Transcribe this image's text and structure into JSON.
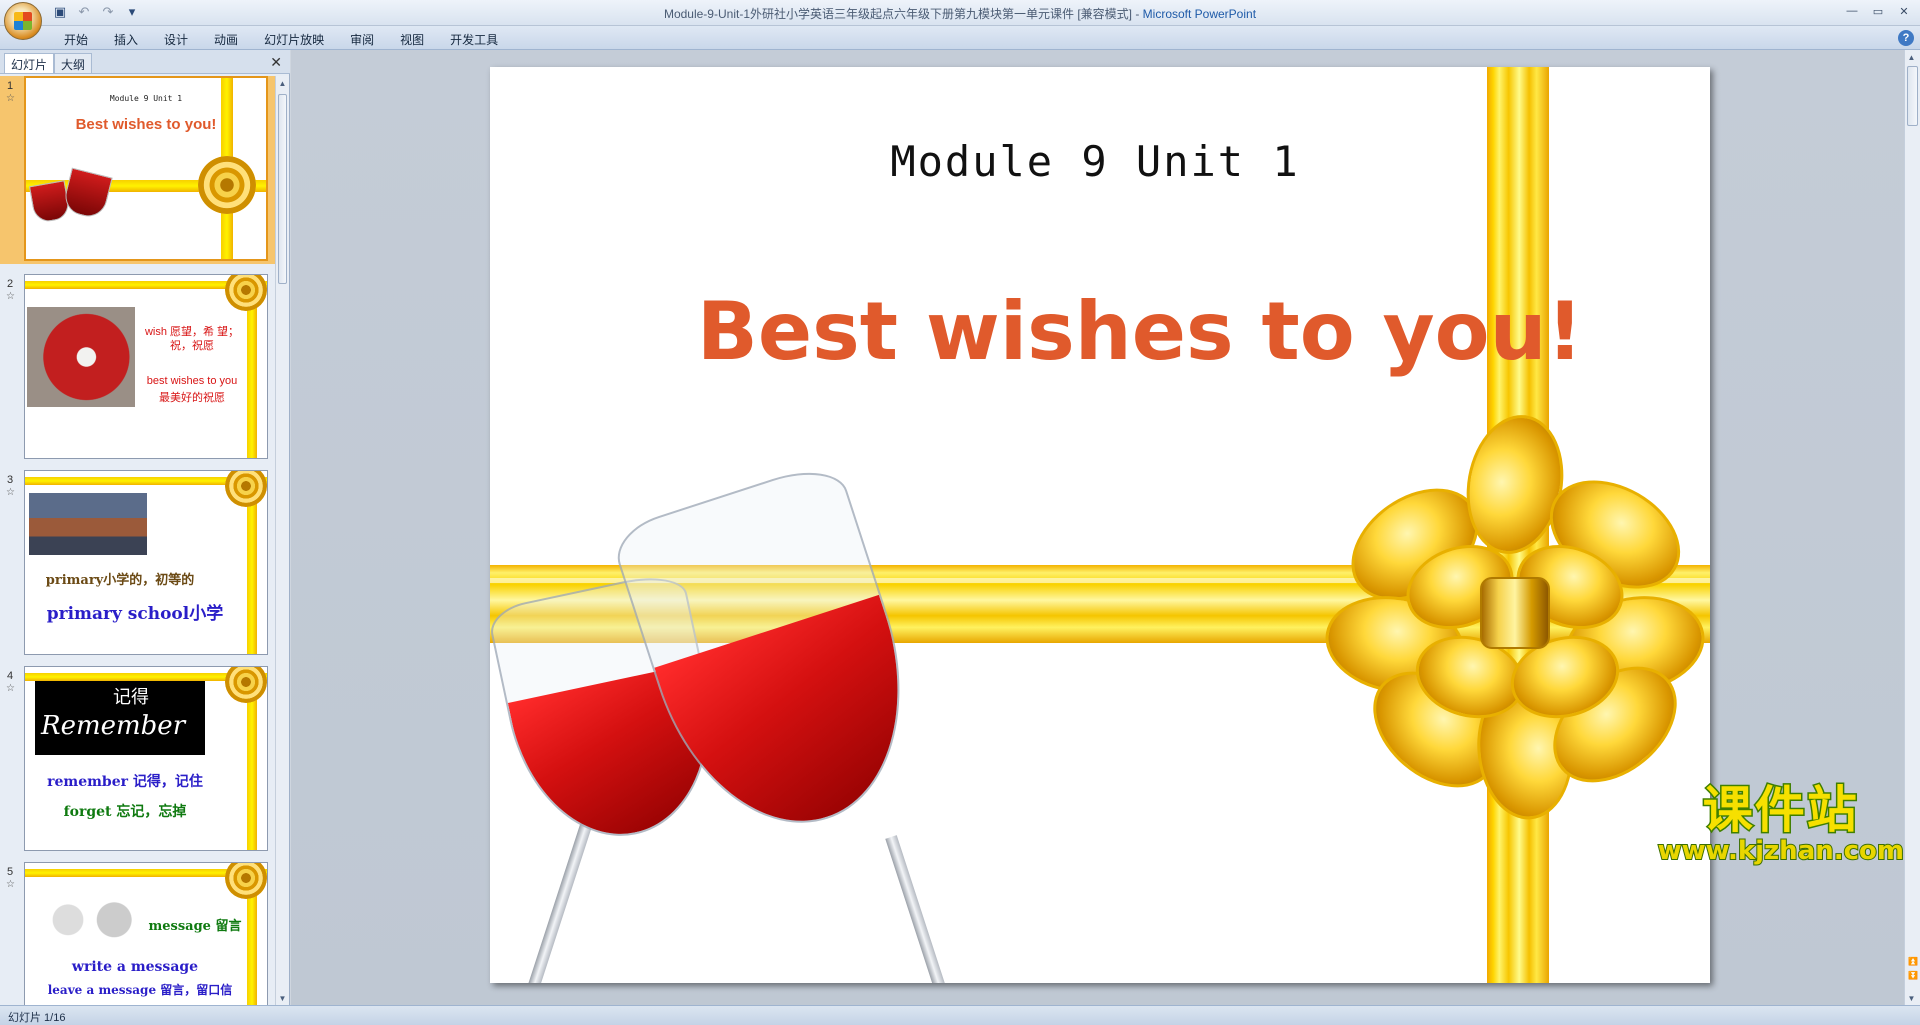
{
  "window": {
    "title": "Module-9-Unit-1外研社小学英语三年级起点六年级下册第九模块第一单元课件 [兼容模式] - ",
    "app_name": "Microsoft PowerPoint",
    "controls": [
      "—",
      "▭",
      "✕"
    ]
  },
  "quick_access": {
    "save_icon": "save-icon",
    "undo_icon": "undo-icon",
    "redo_icon": "redo-icon",
    "customize_icon": "dropdown-icon"
  },
  "ribbon": {
    "tabs": [
      "开始",
      "插入",
      "设计",
      "动画",
      "幻灯片放映",
      "审阅",
      "视图",
      "开发工具"
    ],
    "help": "?"
  },
  "left_panel": {
    "tabs": [
      "幻灯片",
      "大纲"
    ],
    "close": "✕",
    "thumbnails": [
      {
        "number": "1",
        "subtitle": "Module 9 Unit 1",
        "title": "Best wishes to you!"
      },
      {
        "number": "2",
        "line1": "wish 愿望，希  望；",
        "line2": "祝，祝愿",
        "line3": "best wishes to you",
        "line4": "最美好的祝愿"
      },
      {
        "number": "3",
        "line1": "primary小学的，初等的",
        "line2": "primary school小学"
      },
      {
        "number": "4",
        "image_text": "记得",
        "image_text2": "Remember",
        "line1": "remember 记得，记住",
        "line2": "forget 忘记，忘掉"
      },
      {
        "number": "5",
        "line1": "message 留言",
        "line2": "write a message",
        "line3": "leave a message 留言，留口信"
      }
    ]
  },
  "slide": {
    "subtitle": "Module 9 Unit 1",
    "title": "Best wishes to you!",
    "title_color": "#e05a2c"
  },
  "watermark": {
    "chinese": "课件站",
    "url": "www.kjzhan.com"
  },
  "status": {
    "slide_indicator": "幻灯片 1/16"
  }
}
